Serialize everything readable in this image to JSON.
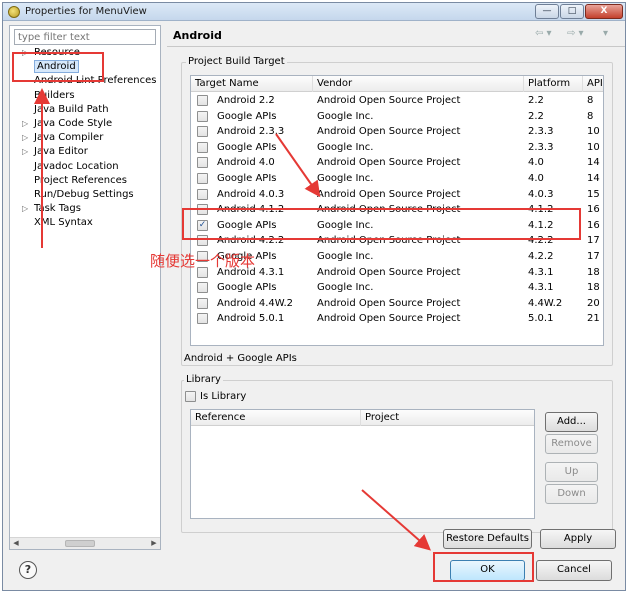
{
  "window": {
    "title": "Properties for MenuView",
    "controls": {
      "minimize": "—",
      "maximize": "□",
      "close": "X"
    }
  },
  "sidebar": {
    "filter_placeholder": "type filter text",
    "items": [
      {
        "label": "Resource",
        "expandable": true
      },
      {
        "label": "Android",
        "expandable": false,
        "selected": true
      },
      {
        "label": "Android Lint Preferences",
        "expandable": false
      },
      {
        "label": "Builders",
        "expandable": false
      },
      {
        "label": "Java Build Path",
        "expandable": false
      },
      {
        "label": "Java Code Style",
        "expandable": true
      },
      {
        "label": "Java Compiler",
        "expandable": true
      },
      {
        "label": "Java Editor",
        "expandable": true
      },
      {
        "label": "Javadoc Location",
        "expandable": false
      },
      {
        "label": "Project References",
        "expandable": false
      },
      {
        "label": "Run/Debug Settings",
        "expandable": false
      },
      {
        "label": "Task Tags",
        "expandable": true
      },
      {
        "label": "XML Syntax",
        "expandable": false
      }
    ],
    "scroll_left": "◀",
    "scroll_right": "▶"
  },
  "page": {
    "title": "Android",
    "nav_back": "⇦ ▾",
    "nav_forward": "⇨ ▾",
    "menu": "▾"
  },
  "build_target": {
    "group_label": "Project Build Target",
    "columns": [
      "Target Name",
      "Vendor",
      "Platform",
      "API ..."
    ],
    "rows": [
      {
        "name": "Android 2.2",
        "vendor": "Android Open Source Project",
        "platform": "2.2",
        "api": "8",
        "checked": false
      },
      {
        "name": "Google APIs",
        "vendor": "Google Inc.",
        "platform": "2.2",
        "api": "8",
        "checked": false
      },
      {
        "name": "Android 2.3.3",
        "vendor": "Android Open Source Project",
        "platform": "2.3.3",
        "api": "10",
        "checked": false
      },
      {
        "name": "Google APIs",
        "vendor": "Google Inc.",
        "platform": "2.3.3",
        "api": "10",
        "checked": false
      },
      {
        "name": "Android 4.0",
        "vendor": "Android Open Source Project",
        "platform": "4.0",
        "api": "14",
        "checked": false
      },
      {
        "name": "Google APIs",
        "vendor": "Google Inc.",
        "platform": "4.0",
        "api": "14",
        "checked": false
      },
      {
        "name": "Android 4.0.3",
        "vendor": "Android Open Source Project",
        "platform": "4.0.3",
        "api": "15",
        "checked": false
      },
      {
        "name": "Android 4.1.2",
        "vendor": "Android Open Source Project",
        "platform": "4.1.2",
        "api": "16",
        "checked": false
      },
      {
        "name": "Google APIs",
        "vendor": "Google Inc.",
        "platform": "4.1.2",
        "api": "16",
        "checked": true
      },
      {
        "name": "Android 4.2.2",
        "vendor": "Android Open Source Project",
        "platform": "4.2.2",
        "api": "17",
        "checked": false
      },
      {
        "name": "Google APIs",
        "vendor": "Google Inc.",
        "platform": "4.2.2",
        "api": "17",
        "checked": false
      },
      {
        "name": "Android 4.3.1",
        "vendor": "Android Open Source Project",
        "platform": "4.3.1",
        "api": "18",
        "checked": false
      },
      {
        "name": "Google APIs",
        "vendor": "Google Inc.",
        "platform": "4.3.1",
        "api": "18",
        "checked": false
      },
      {
        "name": "Android 4.4W.2",
        "vendor": "Android Open Source Project",
        "platform": "4.4W.2",
        "api": "20",
        "checked": false
      },
      {
        "name": "Android 5.0.1",
        "vendor": "Android Open Source Project",
        "platform": "5.0.1",
        "api": "21",
        "checked": false
      }
    ],
    "selected_summary": "Android + Google APIs",
    "check_mark": "✓"
  },
  "library": {
    "group_label": "Library",
    "is_library_label": "Is Library",
    "columns": [
      "Reference",
      "Project"
    ],
    "buttons": {
      "add": "Add...",
      "remove": "Remove",
      "up": "Up",
      "down": "Down"
    }
  },
  "actions": {
    "restore_defaults": "Restore Defaults",
    "apply": "Apply",
    "ok": "OK",
    "cancel": "Cancel",
    "help": "?"
  },
  "annotation": {
    "note": "随便选一个版本",
    "color": "#e53935"
  }
}
